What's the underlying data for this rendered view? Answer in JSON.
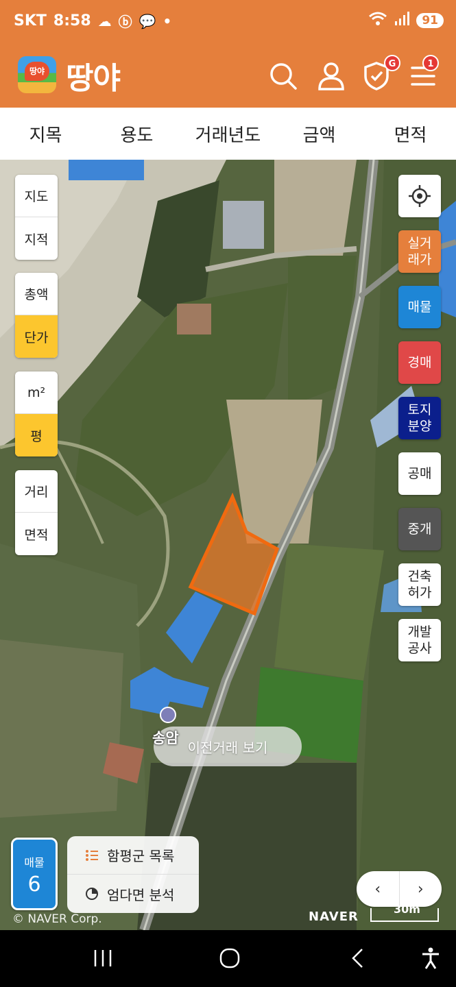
{
  "status": {
    "carrier": "SKT",
    "time": "8:58",
    "battery": "91"
  },
  "app": {
    "logo_badge": "땅야",
    "name": "땅야",
    "notifications_badge": "G",
    "menu_badge": "1"
  },
  "filters": [
    "지목",
    "용도",
    "거래년도",
    "금액",
    "면적"
  ],
  "left_controls": {
    "map_type": [
      "지도",
      "지적"
    ],
    "price_type": [
      "총액",
      "단가"
    ],
    "unit": [
      "m²",
      "평"
    ],
    "measure": [
      "거리",
      "면적"
    ]
  },
  "right_buttons": [
    {
      "label": "실거\n래가",
      "color": "#E57F3C"
    },
    {
      "label": "매물",
      "color": "#1E86D6"
    },
    {
      "label": "경매",
      "color": "#E04848"
    },
    {
      "label": "토지\n분양",
      "color": "#0B1F8C"
    },
    {
      "label": "공매",
      "color": "#FFFFFF"
    },
    {
      "label": "중개",
      "color": "#555555"
    },
    {
      "label": "건축\n허가",
      "color": "#FFFFFF"
    },
    {
      "label": "개발\n공사",
      "color": "#FFFFFF"
    }
  ],
  "map": {
    "place_name": "송암",
    "prev_deal_button": "이전거래 보기",
    "listing_label": "매물",
    "listing_count": "6",
    "info_rows": [
      "함평군 목록",
      "엄다면 분석"
    ],
    "copyright": "© NAVER Corp.",
    "brand": "NAVER",
    "scale": "30m"
  }
}
